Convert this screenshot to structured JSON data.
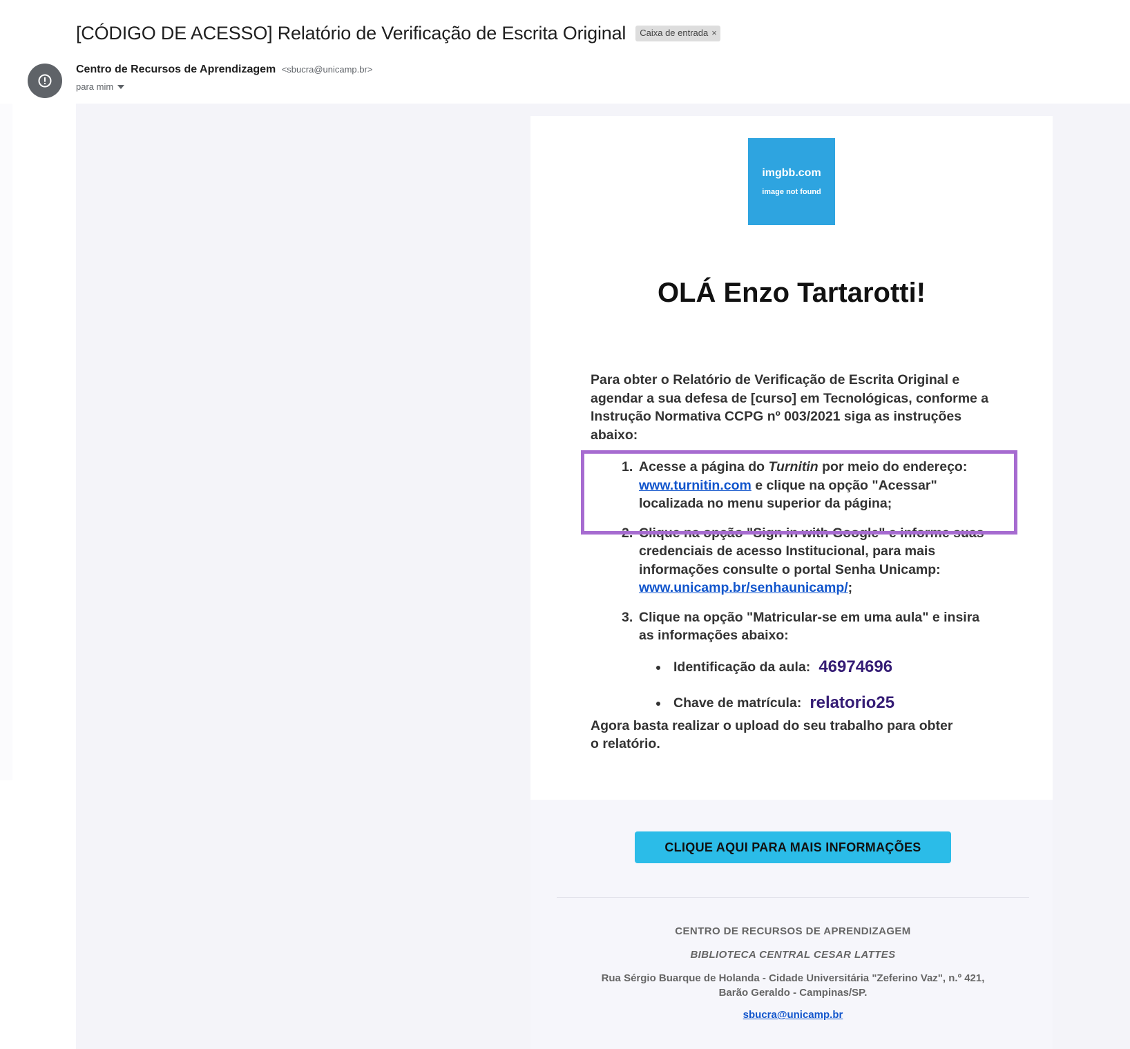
{
  "email": {
    "subject": "[CÓDIGO DE ACESSO] Relatório de Verificação de Escrita Original",
    "label_chip": "Caixa de entrada",
    "label_chip_close": "×",
    "sender_name": "Centro de Recursos de Aprendizagem",
    "sender_email": "<sbucra@unicamp.br>",
    "recipient": "para mim",
    "avatar_icon": "alert-circle-icon"
  },
  "image_placeholder": {
    "title": "imgbb.com",
    "subtitle": "image not found",
    "color": "#2ea4e0"
  },
  "message": {
    "greeting": "OLÁ Enzo Tartarotti!",
    "intro": "Para obter o Relatório de Verificação de Escrita Original e agendar a sua defesa de [curso] em Tecnológicas, conforme a Instrução Normativa CCPG nº 003/2021 siga as instruções abaixo:",
    "steps": [
      {
        "number": "1.",
        "text_a": "Acesse a página do ",
        "text_italic": "Turnitin",
        "text_b": " por meio do endereço: ",
        "link": "www.turnitin.com",
        "text_c": " e clique na opção \"Acessar\" localizada no menu superior da página;"
      },
      {
        "number": "2.",
        "text_a": "Clique na opção \"Sign in with Google\" e informe suas credenciais de acesso Institucional, para mais informações consulte o portal Senha Unicamp: ",
        "link": "www.unicamp.br/senhaunicamp/",
        "text_b": ";"
      },
      {
        "number": "3.",
        "text": "Clique na opção \"Matricular-se em uma aula\" e insira as informações abaixo:"
      }
    ],
    "class_info": [
      {
        "label": "Identificação da aula:",
        "value": "46974696"
      },
      {
        "label": "Chave de matrícula:",
        "value": "relatorio25"
      }
    ],
    "closing": "Agora basta realizar o upload do seu trabalho para obter o relatório.",
    "cta_label": "CLIQUE AQUI PARA MAIS INFORMAÇÕES",
    "highlight_color": "#a66bd0",
    "cta_color": "#2bbce8"
  },
  "footer": {
    "org": "CENTRO DE RECURSOS DE APRENDIZAGEM",
    "library": "BIBLIOTECA CENTRAL CESAR LATTES",
    "address_line1": "Rua Sérgio Buarque de Holanda - Cidade Universitária \"Zeferino Vaz\", n.º 421,",
    "address_line2": "Barão Geraldo - Campinas/SP.",
    "email": "sbucra@unicamp.br"
  }
}
